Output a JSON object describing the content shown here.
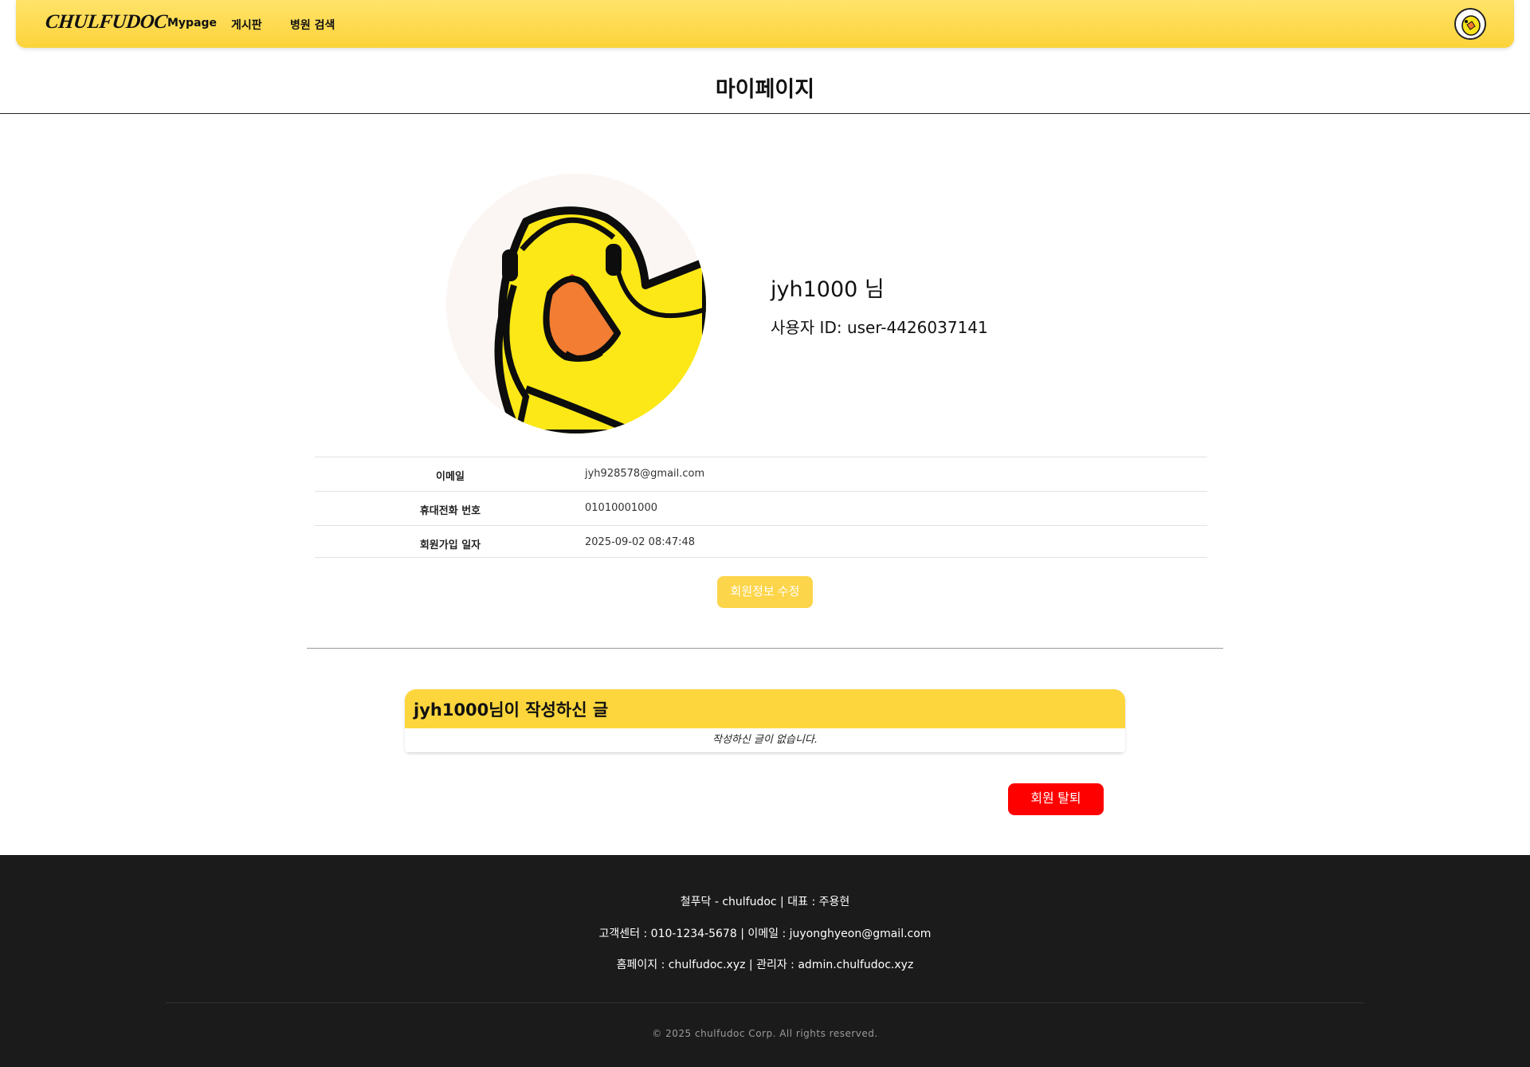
{
  "nav": {
    "logo": "CHULFUDOC",
    "links": [
      "Mypage",
      "게시판",
      "병원 검색"
    ]
  },
  "page": {
    "title": "마이페이지"
  },
  "profile": {
    "username": "jyh1000 님",
    "user_id": "사용자 ID: user-4426037141"
  },
  "info": [
    {
      "label": "이메일",
      "value": "jyh928578@gmail.com"
    },
    {
      "label": "휴대전화 번호",
      "value": "01010001000"
    },
    {
      "label": "회원가입 일자",
      "value": "2025-09-02 08:47:48"
    }
  ],
  "actions": {
    "edit": "회원정보 수정",
    "withdraw": "회원 탈퇴"
  },
  "posts": {
    "header": "jyh1000님이 작성하신 글",
    "empty": "작성하신 글이 없습니다."
  },
  "footer": {
    "line1": "철푸닥 - chulfudoc | 대표 : 주용현",
    "line2": "고객센터 : 010-1234-5678 | 이메일 : juyonghyeon@gmail.com",
    "line3": "홈페이지 : chulfudoc.xyz | 관리자 : admin.chulfudoc.xyz",
    "copyright": "© 2025 chulfudoc Corp. All rights reserved."
  },
  "colors": {
    "brand_yellow": "#fdd63d",
    "danger": "#ff0000",
    "footer_bg": "#1b1b1b"
  }
}
